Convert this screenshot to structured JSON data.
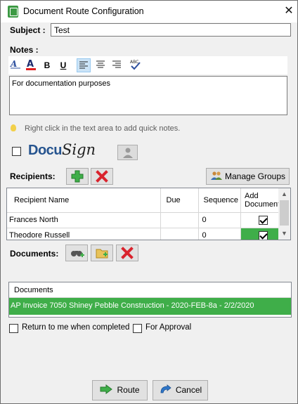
{
  "window": {
    "title": "Document Route Configuration",
    "close_glyph": "✕"
  },
  "subject": {
    "label": "Subject :",
    "value": "Test"
  },
  "notes": {
    "label": "Notes :",
    "toolbar": {
      "font_icon": "font-icon",
      "color_icon": "font-color-icon",
      "bold": "B",
      "underline": "U",
      "align_left_icon": "align-left-icon",
      "align_center_icon": "align-center-icon",
      "align_right_icon": "align-right-icon",
      "spellcheck_icon": "spellcheck-icon"
    },
    "text": "For documentation purposes"
  },
  "hint": "Right click in the text area to add quick notes.",
  "docusign": {
    "docu": "Docu",
    "sign": "Sign"
  },
  "recipients": {
    "label": "Recipients:",
    "manage_groups": "Manage Groups",
    "columns": [
      "Recipient Name",
      "Due",
      "Sequence",
      "Add Documents"
    ],
    "rows": [
      {
        "name": "Frances North",
        "due": "",
        "sequence": "0",
        "add_documents": true
      },
      {
        "name": "Theodore Russell",
        "due": "",
        "sequence": "0",
        "add_documents": true
      }
    ]
  },
  "documents": {
    "label": "Documents:",
    "header": "Documents",
    "items": [
      "AP Invoice 7050 Shiney Pebble Construction - 2020-FEB-8a - 2/2/2020"
    ]
  },
  "options": {
    "return_label": "Return to me when completed",
    "approval_label": "For Approval"
  },
  "actions": {
    "route": "Route",
    "cancel": "Cancel"
  },
  "colors": {
    "accent_green": "#3fae49",
    "delete_red": "#d9232d"
  }
}
